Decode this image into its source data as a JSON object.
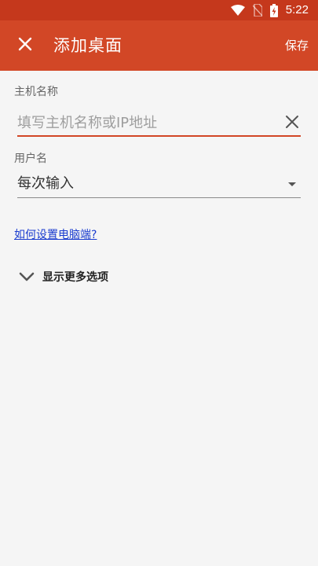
{
  "status_bar": {
    "time": "5:22",
    "icons": [
      "wifi-icon",
      "no-sim-icon",
      "battery-charging-icon"
    ]
  },
  "app_bar": {
    "close_icon": "close-icon",
    "title": "添加桌面",
    "save_label": "保存"
  },
  "form": {
    "host_label": "主机名称",
    "host_value": "",
    "host_placeholder": "填写主机名称或IP地址",
    "clear_icon": "clear-icon",
    "user_label": "用户名",
    "user_selected": "每次输入"
  },
  "help_link": "如何设置电脑端?",
  "more_options_label": "显示更多选项",
  "colors": {
    "accent": "#d24726",
    "status_bar": "#c5381c",
    "link": "#1a3ccf",
    "background": "#f5f5f5"
  }
}
